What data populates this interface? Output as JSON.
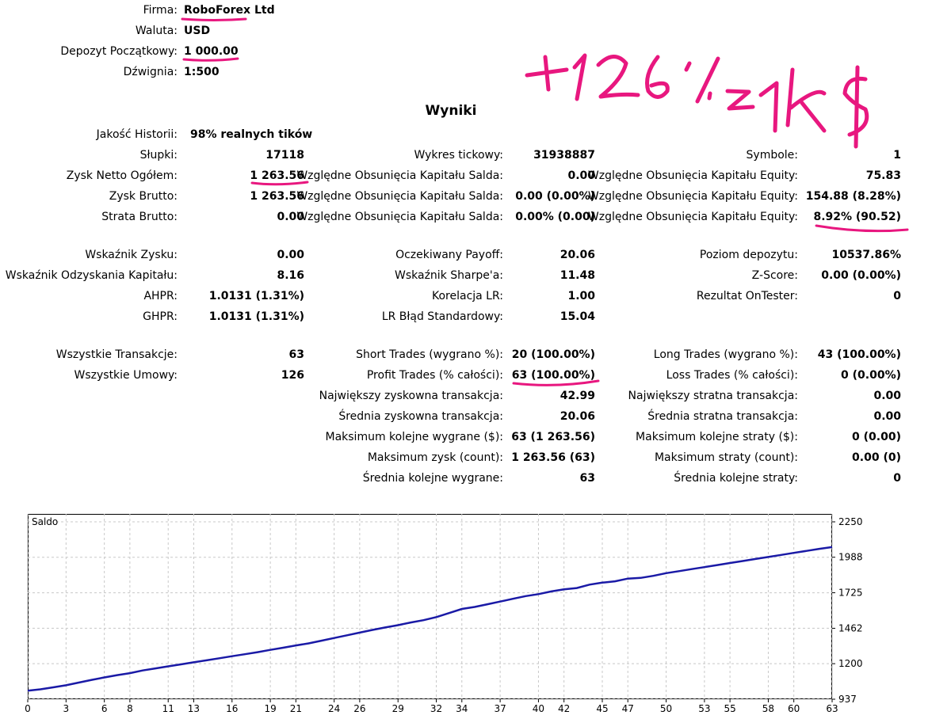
{
  "header": [
    {
      "label": "Firma:",
      "value": "RoboForex Ltd"
    },
    {
      "label": "Waluta:",
      "value": "USD"
    },
    {
      "label": "Depozyt Początkowy:",
      "value": "1 000.00"
    },
    {
      "label": "Dźwignia:",
      "value": "1:500"
    }
  ],
  "annotation": {
    "text": "+126% z 1k$",
    "color": "#e8177f"
  },
  "section_title": "Wyniki",
  "history_quality": {
    "label": "Jakość Historii:",
    "value": "98% realnych tików"
  },
  "col1": [
    {
      "label": "Słupki:",
      "value": "17118"
    },
    {
      "label": "Zysk Netto Ogółem:",
      "value": "1 263.56"
    },
    {
      "label": "Zysk Brutto:",
      "value": "1 263.56"
    },
    {
      "label": "Strata Brutto:",
      "value": "0.00"
    },
    {
      "label": "Wskaźnik Zysku:",
      "value": "0.00"
    },
    {
      "label": "Wskaźnik Odzyskania Kapitału:",
      "value": "8.16"
    },
    {
      "label": "AHPR:",
      "value": "1.0131 (1.31%)"
    },
    {
      "label": "GHPR:",
      "value": "1.0131 (1.31%)"
    },
    {
      "label": "Wszystkie Transakcje:",
      "value": "63"
    },
    {
      "label": "Wszystkie Umowy:",
      "value": "126"
    }
  ],
  "col2": [
    {
      "label": "Wykres tickowy:",
      "value": "31938887"
    },
    {
      "label": "Względne Obsunięcia Kapitału Salda:",
      "value": "0.00"
    },
    {
      "label": "Względne Obsunięcia Kapitału Salda:",
      "value": "0.00 (0.00%)"
    },
    {
      "label": "Względne Obsunięcia Kapitału Salda:",
      "value": "0.00% (0.00)"
    },
    {
      "label": "Oczekiwany Payoff:",
      "value": "20.06"
    },
    {
      "label": "Wskaźnik Sharpe'a:",
      "value": "11.48"
    },
    {
      "label": "Korelacja LR:",
      "value": "1.00"
    },
    {
      "label": "LR Błąd Standardowy:",
      "value": "15.04"
    },
    {
      "label": "Short Trades (wygrano %):",
      "value": "20 (100.00%)"
    },
    {
      "label": "Profit Trades (% całości):",
      "value": "63 (100.00%)"
    },
    {
      "label": "Największy zyskowna transakcja:",
      "value": "42.99"
    },
    {
      "label": "Średnia zyskowna transakcja:",
      "value": "20.06"
    },
    {
      "label": "Maksimum kolejne wygrane ($):",
      "value": "63 (1 263.56)"
    },
    {
      "label": "Maksimum zysk (count):",
      "value": "1 263.56 (63)"
    },
    {
      "label": "Średnia kolejne wygrane:",
      "value": "63"
    }
  ],
  "col3": [
    {
      "label": "Symbole:",
      "value": "1"
    },
    {
      "label": "Względne Obsunięcia Kapitału Equity:",
      "value": "75.83"
    },
    {
      "label": "Względne Obsunięcia Kapitału Equity:",
      "value": "154.88 (8.28%)"
    },
    {
      "label": "Względne Obsunięcia Kapitału Equity:",
      "value": "8.92% (90.52)"
    },
    {
      "label": "Poziom depozytu:",
      "value": "10537.86%"
    },
    {
      "label": "Z-Score:",
      "value": "0.00 (0.00%)"
    },
    {
      "label": "Rezultat OnTester:",
      "value": "0"
    },
    {
      "label": "Long Trades (wygrano %):",
      "value": "43 (100.00%)"
    },
    {
      "label": "Loss Trades (% całości):",
      "value": "0 (0.00%)"
    },
    {
      "label": "Największy stratna transakcja:",
      "value": "0.00"
    },
    {
      "label": "Średnia stratna transakcja:",
      "value": "0.00"
    },
    {
      "label": "Maksimum kolejne straty ($):",
      "value": "0 (0.00)"
    },
    {
      "label": "Maksimum straty (count):",
      "value": "0.00 (0)"
    },
    {
      "label": "Średnia kolejne straty:",
      "value": "0"
    }
  ],
  "chart_data": {
    "type": "line",
    "title": "Saldo",
    "x_ticks": [
      "0",
      "3",
      "6",
      "8",
      "11",
      "13",
      "16",
      "19",
      "21",
      "24",
      "26",
      "29",
      "32",
      "34",
      "37",
      "40",
      "42",
      "45",
      "47",
      "50",
      "53",
      "55",
      "58",
      "60",
      "63"
    ],
    "y_ticks": [
      "2250",
      "1988",
      "1725",
      "1462",
      "1200",
      "937"
    ],
    "ylim": [
      937,
      2250
    ],
    "xlim": [
      0,
      63
    ],
    "grid": true,
    "line_color": "#1a1aa6",
    "series": [
      {
        "x": [
          0,
          1,
          2,
          3,
          4,
          5,
          6,
          7,
          8,
          9,
          10,
          11,
          12,
          13,
          14,
          15,
          16,
          17,
          18,
          19,
          20,
          21,
          22,
          23,
          24,
          25,
          26,
          27,
          28,
          29,
          30,
          31,
          32,
          33,
          34,
          35,
          36,
          37,
          38,
          39,
          40,
          41,
          42,
          43,
          44,
          45,
          46,
          47,
          48,
          49,
          50,
          51,
          52,
          53,
          54,
          55,
          56,
          57,
          58,
          59,
          60,
          61,
          62,
          63
        ],
        "y": [
          1000,
          1010,
          1025,
          1040,
          1060,
          1080,
          1098,
          1115,
          1130,
          1150,
          1165,
          1180,
          1195,
          1210,
          1225,
          1240,
          1255,
          1270,
          1285,
          1302,
          1318,
          1335,
          1350,
          1370,
          1390,
          1410,
          1430,
          1450,
          1468,
          1485,
          1505,
          1522,
          1545,
          1575,
          1605,
          1620,
          1640,
          1660,
          1680,
          1700,
          1715,
          1735,
          1750,
          1760,
          1785,
          1800,
          1810,
          1830,
          1835,
          1850,
          1870,
          1885,
          1900,
          1915,
          1930,
          1945,
          1960,
          1975,
          1990,
          2005,
          2020,
          2035,
          2050,
          2063
        ]
      }
    ]
  }
}
